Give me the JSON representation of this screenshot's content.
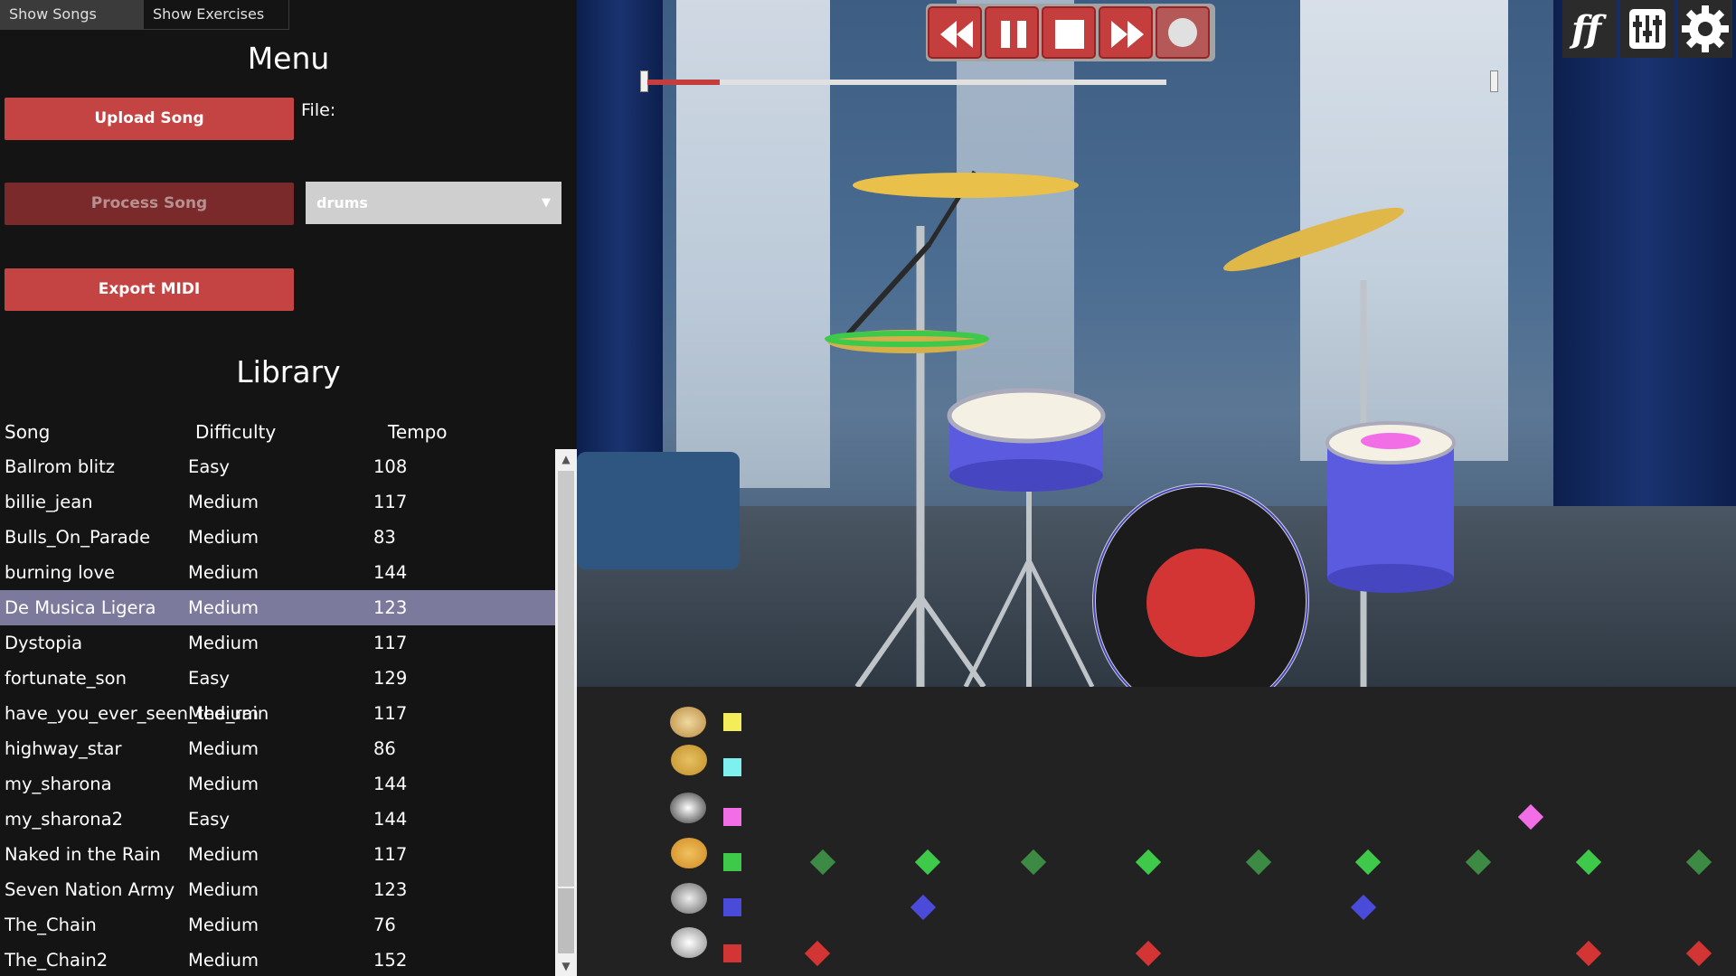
{
  "tabs": {
    "songs": "Show Songs",
    "exercises": "Show Exercises"
  },
  "menu": {
    "title": "Menu",
    "upload_label": "Upload Song",
    "file_label": "File:",
    "process_label": "Process Song",
    "stem_selected": "drums",
    "export_label": "Export MIDI"
  },
  "library": {
    "title": "Library",
    "columns": [
      "Song",
      "Difficulty",
      "Tempo"
    ],
    "selected_index": 4,
    "rows": [
      {
        "song": "Ballrom blitz",
        "difficulty": "Easy",
        "tempo": "108"
      },
      {
        "song": "billie_jean",
        "difficulty": "Medium",
        "tempo": "117"
      },
      {
        "song": "Bulls_On_Parade",
        "difficulty": "Medium",
        "tempo": "83"
      },
      {
        "song": "burning love",
        "difficulty": "Medium",
        "tempo": "144"
      },
      {
        "song": "De Musica Ligera",
        "difficulty": "Medium",
        "tempo": "123"
      },
      {
        "song": "Dystopia",
        "difficulty": "Medium",
        "tempo": "117"
      },
      {
        "song": "fortunate_son",
        "difficulty": "Easy",
        "tempo": "129"
      },
      {
        "song": "have_you_ever_seen_the_rain",
        "difficulty": "Medium",
        "tempo": "117"
      },
      {
        "song": "highway_star",
        "difficulty": "Medium",
        "tempo": "86"
      },
      {
        "song": "my_sharona",
        "difficulty": "Medium",
        "tempo": "144"
      },
      {
        "song": "my_sharona2",
        "difficulty": "Easy",
        "tempo": "144"
      },
      {
        "song": "Naked in the Rain",
        "difficulty": "Medium",
        "tempo": "117"
      },
      {
        "song": "Seven Nation Army",
        "difficulty": "Medium",
        "tempo": "123"
      },
      {
        "song": "The_Chain",
        "difficulty": "Medium",
        "tempo": "76"
      },
      {
        "song": "The_Chain2",
        "difficulty": "Medium",
        "tempo": "152"
      }
    ]
  },
  "transport": {
    "buttons": [
      "rewind-icon",
      "pause-icon",
      "stop-icon",
      "fast-forward-icon",
      "record-icon"
    ],
    "progress_fraction": 0.14
  },
  "toolbar_icons": [
    "ff-logo-icon",
    "mixer-icon",
    "gear-icon"
  ],
  "colors": {
    "accent": "#c44343",
    "lane_yellow": "#f5ec5a",
    "lane_cyan": "#7ef0f0",
    "lane_pink": "#f26ee6",
    "lane_green": "#3fc94a",
    "lane_blue": "#4b4bd9",
    "lane_red": "#d33535"
  },
  "highway": {
    "lanes": [
      {
        "instrument": "crash-cymbal-icon",
        "color": "#f5ec5a"
      },
      {
        "instrument": "ride-cymbal-icon",
        "color": "#7ef0f0"
      },
      {
        "instrument": "tom-icon",
        "color": "#f26ee6"
      },
      {
        "instrument": "hihat-icon",
        "color": "#3fc94a"
      },
      {
        "instrument": "snare-icon",
        "color": "#4b4bd9"
      },
      {
        "instrument": "kick-drum-icon",
        "color": "#d33535"
      }
    ]
  }
}
